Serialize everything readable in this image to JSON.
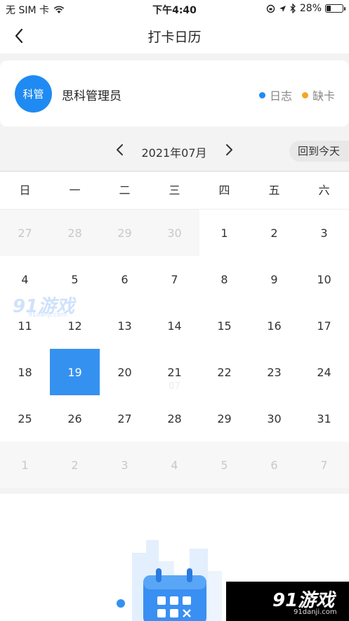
{
  "status": {
    "carrier": "无 SIM 卡",
    "time": "下午4:40",
    "battery": "28%",
    "battery_level": 0.28
  },
  "nav": {
    "title": "打卡日历",
    "back_icon": "chevron-left-icon"
  },
  "user": {
    "avatar_text": "科管",
    "name": "思科管理员",
    "legend": [
      {
        "label": "日志",
        "color": "#1f8bf2"
      },
      {
        "label": "缺卡",
        "color": "#f5a623"
      }
    ]
  },
  "month": {
    "label": "2021年07月",
    "today_button": "回到今天"
  },
  "weekdays": [
    "日",
    "一",
    "二",
    "三",
    "四",
    "五",
    "六"
  ],
  "days": [
    {
      "d": "27",
      "other": true
    },
    {
      "d": "28",
      "other": true
    },
    {
      "d": "29",
      "other": true
    },
    {
      "d": "30",
      "other": true
    },
    {
      "d": "1"
    },
    {
      "d": "2"
    },
    {
      "d": "3"
    },
    {
      "d": "4"
    },
    {
      "d": "5"
    },
    {
      "d": "6"
    },
    {
      "d": "7"
    },
    {
      "d": "8"
    },
    {
      "d": "9"
    },
    {
      "d": "10"
    },
    {
      "d": "11"
    },
    {
      "d": "12"
    },
    {
      "d": "13"
    },
    {
      "d": "14"
    },
    {
      "d": "15"
    },
    {
      "d": "16"
    },
    {
      "d": "17"
    },
    {
      "d": "18"
    },
    {
      "d": "19",
      "selected": true
    },
    {
      "d": "20"
    },
    {
      "d": "21",
      "ghost": "07"
    },
    {
      "d": "22"
    },
    {
      "d": "23"
    },
    {
      "d": "24"
    },
    {
      "d": "25"
    },
    {
      "d": "26"
    },
    {
      "d": "27"
    },
    {
      "d": "28"
    },
    {
      "d": "29"
    },
    {
      "d": "30"
    },
    {
      "d": "31"
    },
    {
      "d": "1",
      "other": true
    },
    {
      "d": "2",
      "other": true
    },
    {
      "d": "3",
      "other": true
    },
    {
      "d": "4",
      "other": true
    },
    {
      "d": "5",
      "other": true
    },
    {
      "d": "6",
      "other": true
    },
    {
      "d": "7",
      "other": true
    }
  ],
  "watermark": {
    "text": "91游戏",
    "sub": "91danji.com"
  }
}
